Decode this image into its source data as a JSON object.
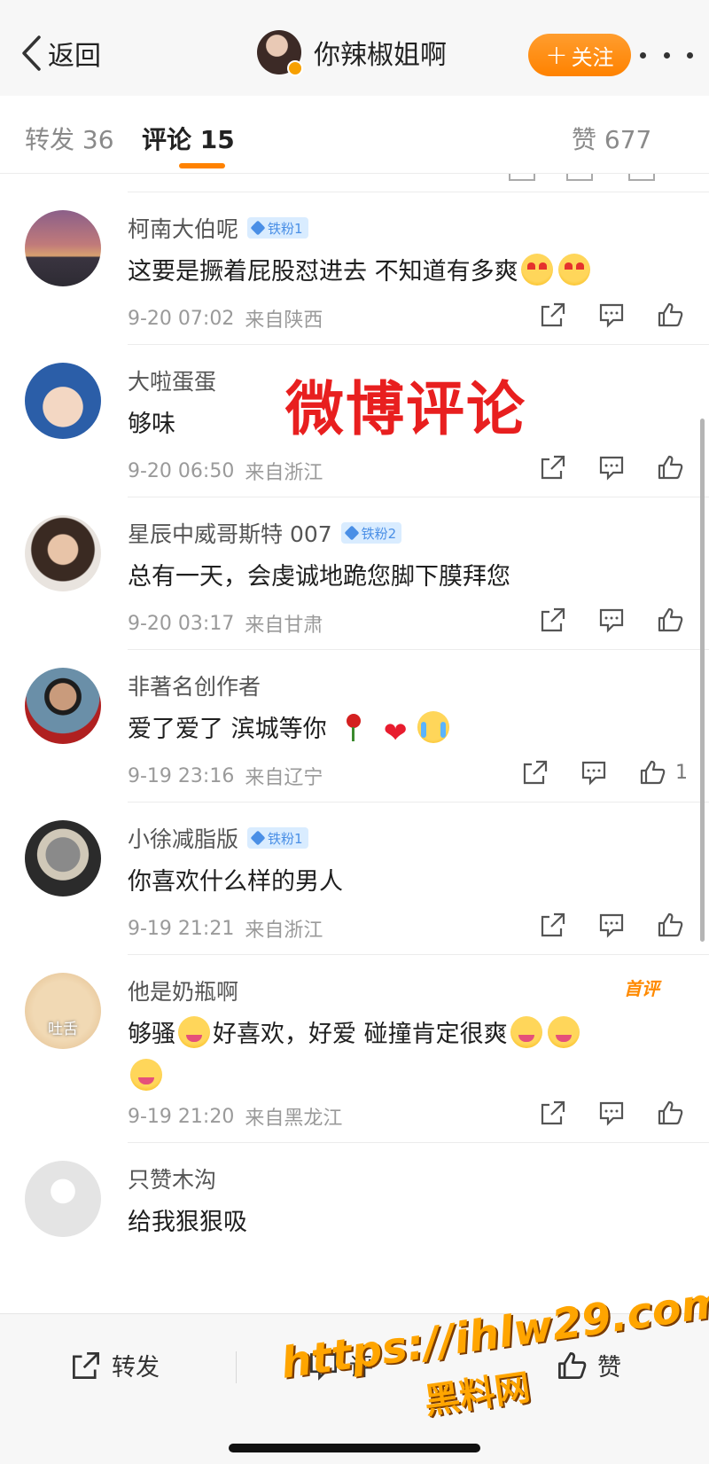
{
  "nav": {
    "back_label": "返回",
    "title": "你辣椒姐啊",
    "follow_label": "关注",
    "accent_color": "#ff8200"
  },
  "tabs": {
    "repost": "转发 36",
    "comments": "评论 15",
    "likes": "赞 677"
  },
  "overlay_text": "微博评论",
  "comments": [
    {
      "name": "柯南大伯呢",
      "badge": "铁粉1",
      "text": "这要是撅着屁股怼进去 不知道有多爽",
      "emojis": [
        "love-tongue",
        "love-tongue"
      ],
      "date": "9-20 07:02",
      "from": "来自陕西",
      "likes": ""
    },
    {
      "name": "大啦蛋蛋",
      "badge": "",
      "text": "够味",
      "emojis": [],
      "date": "9-20 06:50",
      "from": "来自浙江",
      "likes": ""
    },
    {
      "name": "星辰中威哥斯特 007",
      "badge": "铁粉2",
      "text": "总有一天，会虔诚地跪您脚下膜拜您",
      "emojis": [],
      "date": "9-20 03:17",
      "from": "来自甘肃",
      "likes": ""
    },
    {
      "name": "非著名创作者",
      "badge": "",
      "text": "爱了爱了 滨城等你",
      "emojis": [
        "rose",
        "heart",
        "crying"
      ],
      "date": "9-19 23:16",
      "from": "来自辽宁",
      "likes": "1"
    },
    {
      "name": "小徐减脂版",
      "badge": "铁粉1",
      "text": "你喜欢什么样的男人",
      "emojis": [],
      "date": "9-19 21:21",
      "from": "来自浙江",
      "likes": ""
    },
    {
      "name": "他是奶瓶啊",
      "badge": "",
      "first_label": "首评",
      "avatar_caption": "吐舌",
      "text_a": "够骚",
      "text_b": "好喜欢，好爱 碰撞肯定很爽",
      "emojis": [
        "love-drool",
        "love-drool",
        "love-drool",
        "love-drool"
      ],
      "date": "9-19 21:20",
      "from": "来自黑龙江",
      "likes": ""
    },
    {
      "name": "只赞木沟",
      "badge": "",
      "text": "给我狠狠吸",
      "emojis": [],
      "date": "",
      "from": "",
      "likes": ""
    }
  ],
  "bottom_bar": {
    "repost": "转发",
    "comment": "评",
    "like": "赞"
  },
  "watermark": {
    "url": "https://ihlw29.com",
    "site": "黑料网"
  }
}
